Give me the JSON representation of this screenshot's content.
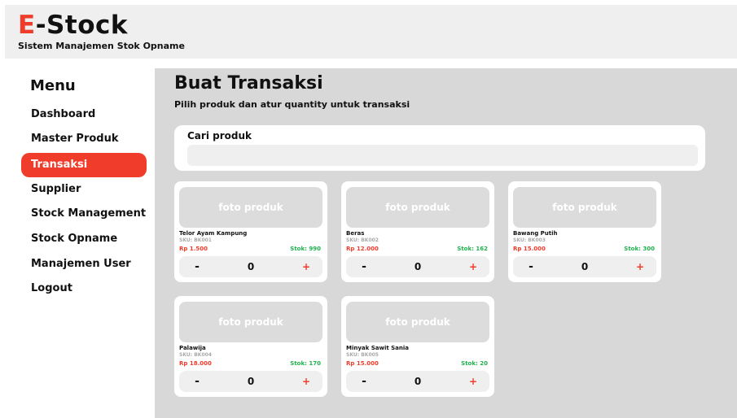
{
  "header": {
    "brand_letter": "E",
    "brand_rest": "-Stock",
    "tagline": "Sistem Manajemen Stok Opname"
  },
  "colors": {
    "accent": "#f03c2a",
    "stock": "#1fb24e",
    "sku": "#a9a9a9"
  },
  "sidebar": {
    "title": "Menu",
    "items": [
      {
        "label": "Dashboard",
        "active": false
      },
      {
        "label": "Master Produk",
        "active": false
      },
      {
        "label": "Transaksi",
        "active": true
      },
      {
        "label": "Supplier",
        "active": false
      },
      {
        "label": "Stock Management",
        "active": false
      },
      {
        "label": "Stock Opname",
        "active": false
      },
      {
        "label": "Manajemen User",
        "active": false
      },
      {
        "label": "Logout",
        "active": false
      }
    ]
  },
  "main": {
    "title": "Buat Transaksi",
    "subtitle": "Pilih produk dan atur quantity untuk transaksi",
    "search": {
      "label": "Cari produk",
      "value": "",
      "placeholder": ""
    },
    "products": [
      {
        "photo": "foto produk",
        "name": "Telor Ayam Kampung",
        "sku": "SKU: BK001",
        "price": "Rp 1.500",
        "stock": "Stok: 990",
        "qty": "0",
        "minus": "-",
        "plus": "+"
      },
      {
        "photo": "foto produk",
        "name": "Beras",
        "sku": "SKU: BK002",
        "price": "Rp 12.000",
        "stock": "Stok: 162",
        "qty": "0",
        "minus": "-",
        "plus": "+"
      },
      {
        "photo": "foto produk",
        "name": "Bawang Putih",
        "sku": "SKU: BK003",
        "price": "Rp 15.000",
        "stock": "Stok: 300",
        "qty": "0",
        "minus": "-",
        "plus": "+"
      },
      {
        "photo": "foto produk",
        "name": "Palawija",
        "sku": "SKU: BK004",
        "price": "Rp 18.000",
        "stock": "Stok: 170",
        "qty": "0",
        "minus": "-",
        "plus": "+"
      },
      {
        "photo": "foto produk",
        "name": "Minyak Sawit Sania",
        "sku": "SKU: BK005",
        "price": "Rp 15.000",
        "stock": "Stok: 20",
        "qty": "0",
        "minus": "-",
        "plus": "+"
      }
    ]
  }
}
